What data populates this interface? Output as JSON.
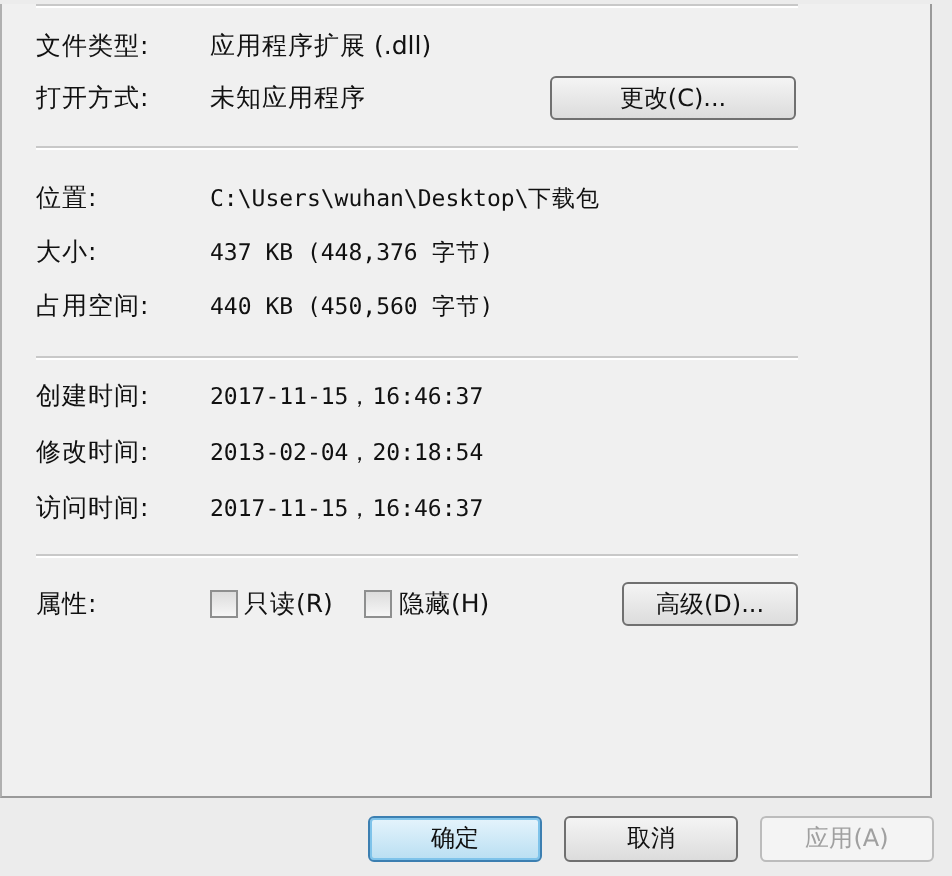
{
  "general": [
    {
      "label": "文件类型:",
      "value": "应用程序扩展 (.dll)"
    },
    {
      "label": "打开方式:",
      "value": "未知应用程序",
      "button": "更改(C)..."
    }
  ],
  "location": [
    {
      "label": "位置:",
      "value": "C:\\Users\\wuhan\\Desktop\\下载包"
    },
    {
      "label": "大小:",
      "value": "437 KB (448,376 字节)"
    },
    {
      "label": "占用空间:",
      "value": "440 KB (450,560 字节)"
    }
  ],
  "times": [
    {
      "label": "创建时间:",
      "value": "2017-11-15，16:46:37"
    },
    {
      "label": "修改时间:",
      "value": "2013-02-04，20:18:54"
    },
    {
      "label": "访问时间:",
      "value": "2017-11-15，16:46:37"
    }
  ],
  "attributes": {
    "label": "属性:",
    "checkboxes": [
      {
        "label": "只读(R)",
        "checked": false
      },
      {
        "label": "隐藏(H)",
        "checked": false
      }
    ],
    "button": "高级(D)..."
  },
  "buttons": [
    {
      "label": "确定",
      "default": true,
      "disabled": false
    },
    {
      "label": "取消",
      "default": false,
      "disabled": false
    },
    {
      "label": "应用(A)",
      "default": false,
      "disabled": true
    }
  ]
}
